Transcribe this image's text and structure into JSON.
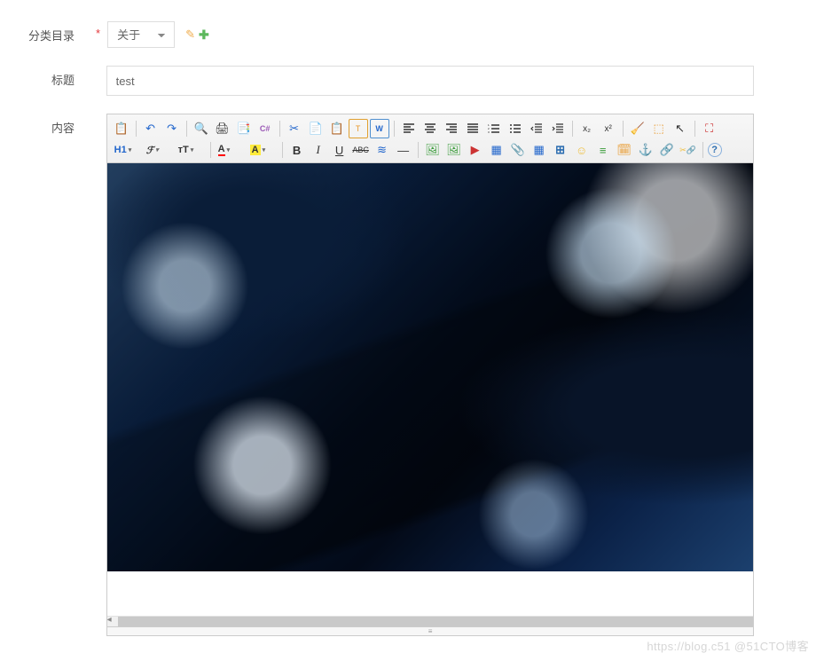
{
  "form": {
    "category": {
      "label": "分类目录",
      "selected": "关于",
      "required": "*"
    },
    "title": {
      "label": "标题",
      "value": "test"
    },
    "content": {
      "label": "内容"
    }
  },
  "icons": {
    "edit": "✎",
    "add": "✚"
  },
  "toolbar": {
    "row1": {
      "paste": "📋",
      "undo": "↶",
      "redo": "↷",
      "preview": "🔍",
      "print": "🖨",
      "template": "📑",
      "code": "C#",
      "cut": "✂",
      "copy": "📄",
      "paste2": "📋",
      "paste_text": "T",
      "paste_word": "W",
      "align_left": "≡",
      "align_center": "≡",
      "align_right": "≡",
      "align_justify": "≡",
      "ol": "≔",
      "ul": "≔",
      "outdent": "⇤",
      "indent": "⇥",
      "sub": "x₂",
      "sup": "x²",
      "clear": "🧹",
      "select_all": "⬚",
      "cursor": "↖",
      "fullscreen": "⛶"
    },
    "row2": {
      "h1": "H1",
      "font_family": "ℱ",
      "font_size": "тT",
      "font_color": "A",
      "back_color": "A",
      "bold": "B",
      "italic": "I",
      "underline": "U",
      "strike": "ABC",
      "line": "≋",
      "hr": "—",
      "img1": "🖼",
      "img2": "🖼",
      "flash": "▶",
      "media": "▦",
      "attach": "📎",
      "table": "▦",
      "baidu": "⊞",
      "emoji": "☺",
      "special": "≡",
      "map": "🗓",
      "anchor": "⚓",
      "link": "🔗",
      "unlink": "✂🔗",
      "help": "?"
    }
  },
  "editor": {
    "resize_handle": "⋮⋮⋮",
    "content_image_alt": "circuit-board-image"
  },
  "watermark": "https://blog.c51 @51CTO博客"
}
